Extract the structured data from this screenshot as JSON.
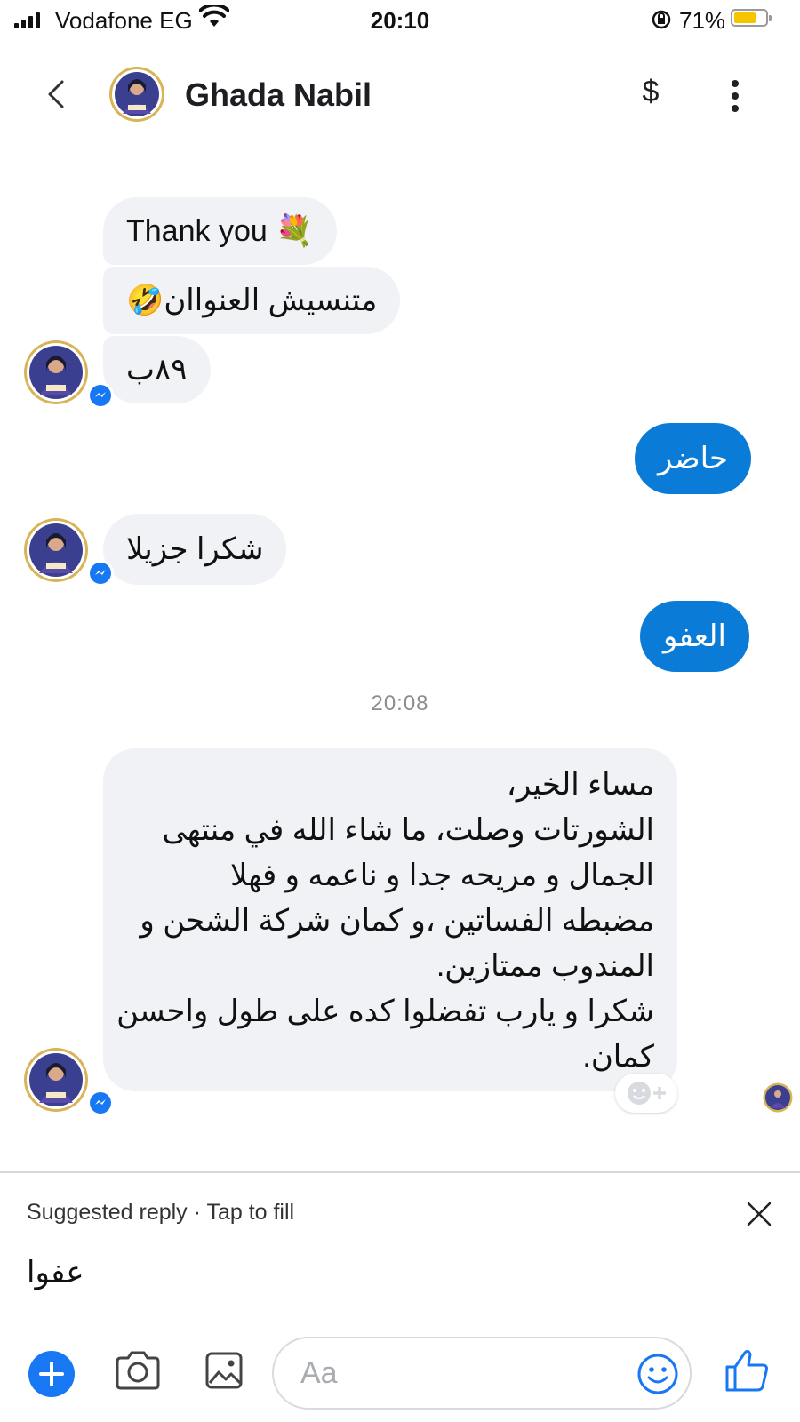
{
  "status_bar": {
    "carrier": "Vodafone EG",
    "time": "20:10",
    "battery_percent": "71%",
    "battery_level": 0.71,
    "colors": {
      "battery_fill": "#f6c500"
    }
  },
  "header": {
    "contact_name": "Ghada Nabil",
    "payment_symbol": "$"
  },
  "messages": [
    {
      "direction": "in",
      "text": "Thank you 💐"
    },
    {
      "direction": "in",
      "text": "متنسيش العنواان🤣"
    },
    {
      "direction": "in",
      "text": "٨٩ب"
    },
    {
      "direction": "out",
      "text": "حاضر"
    },
    {
      "direction": "in",
      "text": "شكرا جزيلا"
    },
    {
      "direction": "out",
      "text": "العفو"
    }
  ],
  "timestamp": "20:08",
  "long_message": {
    "lines": [
      "مساء الخير،",
      "الشورتات وصلت، ما شاء الله في منتهى",
      "الجمال و مريحه جدا و ناعمه و فهلا",
      "مضبطه الفساتين ،و كمان شركة الشحن و",
      "المندوب ممتازين.",
      "شكرا و يارب تفضلوا كده على طول واحسن",
      "كمان."
    ]
  },
  "suggested_reply": {
    "label": "Suggested reply · Tap to fill",
    "text": "عفوا"
  },
  "composer": {
    "placeholder": "Aa"
  },
  "colors": {
    "outgoing_bubble": "#0a7cd8",
    "incoming_bubble": "#f0f2f5",
    "accent": "#1877f2"
  },
  "icons": [
    "back-chevron-icon",
    "dollar-icon",
    "more-vertical-icon",
    "messenger-badge-icon",
    "add-reaction-icon",
    "close-icon",
    "plus-icon",
    "camera-icon",
    "photo-icon",
    "emoji-icon",
    "thumbs-up-icon"
  ]
}
